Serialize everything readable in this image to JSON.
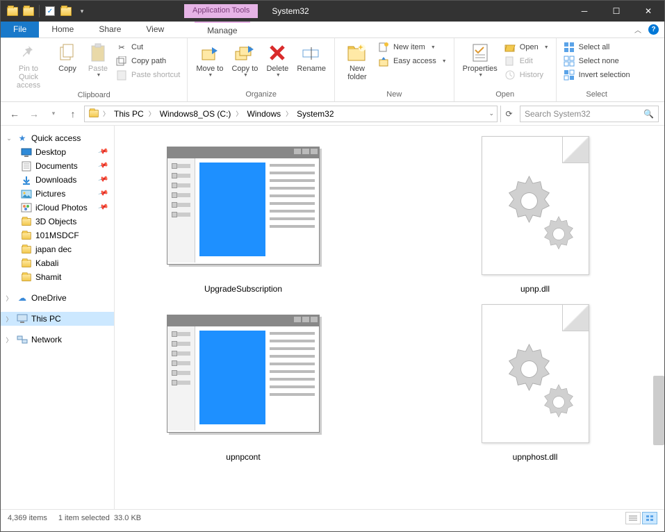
{
  "titlebar": {
    "app_tools": "Application Tools",
    "title": "System32"
  },
  "tabs": {
    "file": "File",
    "home": "Home",
    "share": "Share",
    "view": "View",
    "manage": "Manage"
  },
  "ribbon": {
    "clipboard": {
      "label": "Clipboard",
      "pin": "Pin to Quick access",
      "copy": "Copy",
      "paste": "Paste",
      "cut": "Cut",
      "copy_path": "Copy path",
      "paste_shortcut": "Paste shortcut"
    },
    "organize": {
      "label": "Organize",
      "move": "Move to",
      "copy": "Copy to",
      "delete": "Delete",
      "rename": "Rename"
    },
    "new": {
      "label": "New",
      "folder": "New folder",
      "item": "New item",
      "easy": "Easy access"
    },
    "open": {
      "label": "Open",
      "properties": "Properties",
      "open": "Open",
      "edit": "Edit",
      "history": "History"
    },
    "select": {
      "label": "Select",
      "all": "Select all",
      "none": "Select none",
      "invert": "Invert selection"
    }
  },
  "breadcrumb": [
    "This PC",
    "Windows8_OS (C:)",
    "Windows",
    "System32"
  ],
  "search": {
    "placeholder": "Search System32"
  },
  "tree": {
    "quick_access": "Quick access",
    "items": [
      {
        "label": "Desktop",
        "pinned": true,
        "icon": "desktop"
      },
      {
        "label": "Documents",
        "pinned": true,
        "icon": "doc"
      },
      {
        "label": "Downloads",
        "pinned": true,
        "icon": "down"
      },
      {
        "label": "Pictures",
        "pinned": true,
        "icon": "pic"
      },
      {
        "label": "iCloud Photos",
        "pinned": true,
        "icon": "icloud"
      },
      {
        "label": "3D Objects",
        "pinned": false,
        "icon": "folder"
      },
      {
        "label": "101MSDCF",
        "pinned": false,
        "icon": "folder"
      },
      {
        "label": "japan dec",
        "pinned": false,
        "icon": "folder"
      },
      {
        "label": "Kabali",
        "pinned": false,
        "icon": "folder"
      },
      {
        "label": "Shamit",
        "pinned": false,
        "icon": "folder"
      }
    ],
    "onedrive": "OneDrive",
    "thispc": "This PC",
    "network": "Network"
  },
  "files": [
    {
      "name": "UpgradeSubscription",
      "type": "exe"
    },
    {
      "name": "upnp.dll",
      "type": "dll"
    },
    {
      "name": "upnpcont",
      "type": "exe"
    },
    {
      "name": "upnphost.dll",
      "type": "dll"
    }
  ],
  "status": {
    "count": "4,369 items",
    "selection": "1 item selected",
    "size": "33.0 KB"
  }
}
